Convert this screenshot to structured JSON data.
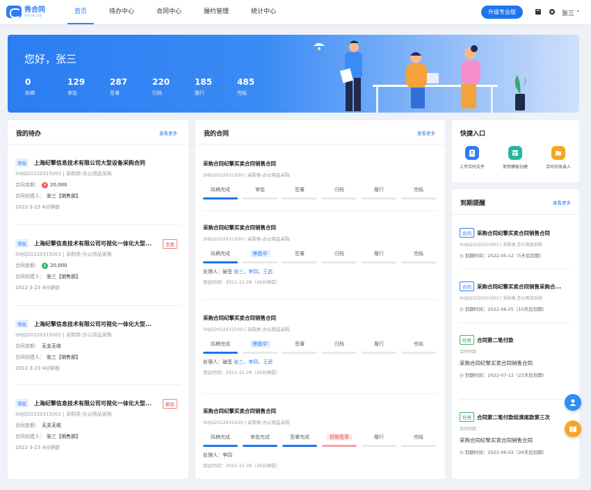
{
  "app": {
    "logo_name": "秀合同",
    "logo_sub": "SHOWCON"
  },
  "nav": {
    "items": [
      "首页",
      "待办中心",
      "合同中心",
      "履约管理",
      "统计中心"
    ]
  },
  "header": {
    "upgrade_label": "升级专业版",
    "user_name": "张三 ˅"
  },
  "banner": {
    "greeting": "您好，张三",
    "stats": [
      {
        "num": "0",
        "label": "拟稿"
      },
      {
        "num": "129",
        "label": "审批"
      },
      {
        "num": "287",
        "label": "签署"
      },
      {
        "num": "220",
        "label": "归档"
      },
      {
        "num": "185",
        "label": "履行"
      },
      {
        "num": "485",
        "label": "完结"
      }
    ]
  },
  "todo": {
    "title": "我的待办",
    "more": "查看更多",
    "items": [
      {
        "tag": "审批",
        "title": "上海纪擎信息技术有限公司大型设备采购合同",
        "badge": "",
        "code": "SHJQ20220315001 | 采购类-办公用品采购",
        "line1_label": "合同金额：",
        "line1_value": "20,000",
        "line2_label": "合同创建人：",
        "line2_value": "张三【销售部】",
        "time": "2022-3-23  4分钟前",
        "money_icon": "¥"
      },
      {
        "tag": "审批",
        "title": "上海纪擎信息技术有限公司可视化一体化大型...",
        "badge": "变更",
        "code": "SHJQ20220315001 | 采购类-办公用品采购",
        "line1_label": "合同金额：",
        "line1_value": "20,000",
        "line2_label": "合同创建人：",
        "line2_value": "张三【销售部】",
        "time": "2022-3-23  4分钟前",
        "money_icon": "$"
      },
      {
        "tag": "审批",
        "title": "上海纪擎信息技术有限公司可视化一体化大型...",
        "badge": "",
        "code": "SHJQ20220315001 | 采购类-办公用品采购",
        "line1_label": "合同金额：",
        "line1_value": "无支无收",
        "line2_label": "合同创建人：",
        "line2_value": "张三【销售部】",
        "time": "2022-3-23  4分钟前",
        "money_icon": ""
      },
      {
        "tag": "审批",
        "title": "上海纪擎信息技术有限公司可视化一体化大型...",
        "badge": "解除",
        "code": "SHJQ20220315001 | 采购类-办公用品采购",
        "line1_label": "合同金额：",
        "line1_value": "无支无收",
        "line2_label": "合同创建人：",
        "line2_value": "张三【销售部】",
        "time": "2022-3-23  4分钟前",
        "money_icon": ""
      }
    ]
  },
  "contracts": {
    "title": "我的合同",
    "more": "查看更多",
    "items": [
      {
        "title": "采购合同纪擎买卖合同销售合同",
        "code": "SHJQ2022031500 | 采购类-办公用品采购",
        "steps": [
          "拟稿完成",
          "审批",
          "签署",
          "归档",
          "履行",
          "完结"
        ],
        "handler_label": "",
        "handler": "",
        "handler_names": "",
        "time": ""
      },
      {
        "title": "采购合同纪擎买卖合同销售合同",
        "code": "SHJQ2022031500 | 采购类-办公用品采购",
        "steps": [
          "拟稿完成",
          "审批中",
          "签署",
          "归档",
          "履行",
          "完结"
        ],
        "handler_label": "处理人：",
        "handler": "破签",
        "handler_names": "张三，李四，王武",
        "time": "到达时间：2021-11-28（26分钟前）"
      },
      {
        "title": "采购合同纪擎买卖合同销售合同",
        "code": "SHJQ2022031500 | 采购类-办公用品采购",
        "steps": [
          "拟稿完成",
          "审批中",
          "签署",
          "归档",
          "履行",
          "完结"
        ],
        "handler_label": "处理人：",
        "handler": "破签",
        "handler_names": "张三，李四，王武",
        "time": "到达时间：2021-11-28（26分钟前）"
      },
      {
        "title": "采购合同纪擎买卖合同销售合同",
        "code": "SHJQ2022031500 | 采购类-办公用品采购",
        "steps": [
          "拟稿完成",
          "审批完成",
          "签署完成",
          "拒绝签章",
          "履行",
          "完结"
        ],
        "handler_label": "处理人：",
        "handler": "",
        "handler_names": "李四",
        "time": "到达时间：2021-11-28（26分钟前）"
      }
    ]
  },
  "quick": {
    "title": "快捷入口",
    "items": [
      {
        "label": "上传合同文件",
        "icon": "upload-file-icon",
        "color": "#2f7cf6"
      },
      {
        "label": "使用模板创建",
        "icon": "template-icon",
        "color": "#2bb5a0"
      },
      {
        "label": "合同台账录入",
        "icon": "ledger-icon",
        "color": "#f5a623"
      }
    ]
  },
  "reminders": {
    "title": "到期提醒",
    "more": "查看更多",
    "items": [
      {
        "tag": "合同",
        "title": "采购合同纪擎买卖合同销售合同",
        "sub": "SHJQ20220315001 | 采购类-办公用品采购",
        "body": "",
        "due": "到期时间：2022-05-12（5天后到期）"
      },
      {
        "tag": "合同",
        "title": "采购合同纪擎买卖合同销售采购合...",
        "sub": "SHJQ20220315001 | 采购类-办公用品采购",
        "body": "",
        "due": "到期时间：2022-06-25（10天后到期）"
      },
      {
        "tag": "任务",
        "title": "合同第二笔付款",
        "sub": "合同付款",
        "body": "采购合同纪擎买卖合同销售合同",
        "due": "到期时间：2022-07-12（22天后到期）"
      },
      {
        "tag": "任务",
        "title": "合同第二笔付款结清尾款第三次",
        "sub": "合同付款",
        "body": "采购合同纪擎买卖合同销售合同",
        "due": "到期时间：2022-06-02（26天后到期）"
      }
    ]
  }
}
